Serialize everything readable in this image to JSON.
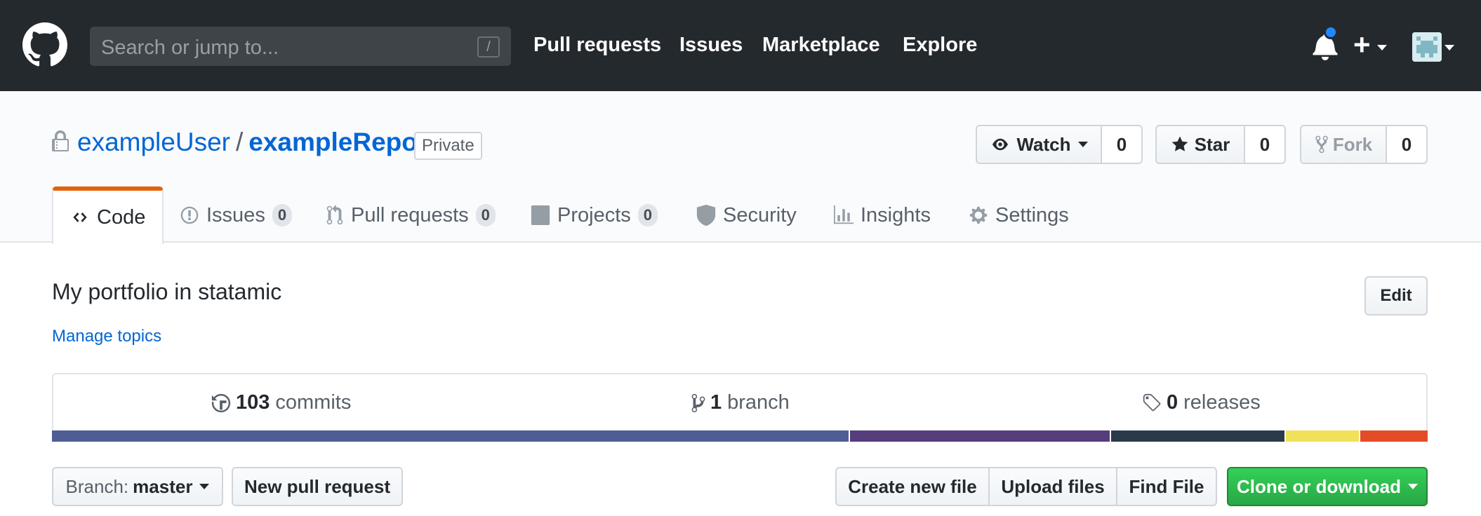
{
  "header": {
    "search_placeholder": "Search or jump to...",
    "slash_key": "/",
    "nav": [
      "Pull requests",
      "Issues",
      "Marketplace",
      "Explore"
    ],
    "plus_label": "+"
  },
  "repo": {
    "owner": "exampleUser",
    "separator": "/",
    "name": "exampleRepo",
    "visibility": "Private",
    "watch": {
      "label": "Watch",
      "count": "0"
    },
    "star": {
      "label": "Star",
      "count": "0"
    },
    "fork": {
      "label": "Fork",
      "count": "0"
    }
  },
  "tabs": [
    {
      "label": "Code",
      "selected": true,
      "icon": "code-icon"
    },
    {
      "label": "Issues",
      "count": "0",
      "icon": "issue-icon"
    },
    {
      "label": "Pull requests",
      "count": "0",
      "icon": "pull-request-icon"
    },
    {
      "label": "Projects",
      "count": "0",
      "icon": "project-icon"
    },
    {
      "label": "Security",
      "icon": "shield-icon"
    },
    {
      "label": "Insights",
      "icon": "graph-icon"
    },
    {
      "label": "Settings",
      "icon": "gear-icon"
    }
  ],
  "description": "My portfolio in statamic",
  "edit_label": "Edit",
  "manage_topics": "Manage topics",
  "summary": {
    "commits": {
      "count": "103",
      "label": "commits"
    },
    "branches": {
      "count": "1",
      "label": "branch"
    },
    "releases": {
      "count": "0",
      "label": "releases"
    }
  },
  "languages": [
    {
      "color": "#4F5D95",
      "percent": 58.0
    },
    {
      "color": "#563d7c",
      "percent": 19.0
    },
    {
      "color": "#2b3a4a",
      "percent": 12.7
    },
    {
      "color": "#f1e05a",
      "percent": 5.4
    },
    {
      "color": "#e34c26",
      "percent": 4.9
    }
  ],
  "actions": {
    "branch_prefix": "Branch:",
    "branch_name": "master",
    "new_pull_request": "New pull request",
    "create_file": "Create new file",
    "upload_files": "Upload files",
    "find_file": "Find File",
    "clone": "Clone or download"
  },
  "colors": {
    "header_bg": "#24292e",
    "link": "#0366d6",
    "accent_tab": "#e36209",
    "clone_green": "#28a745"
  }
}
